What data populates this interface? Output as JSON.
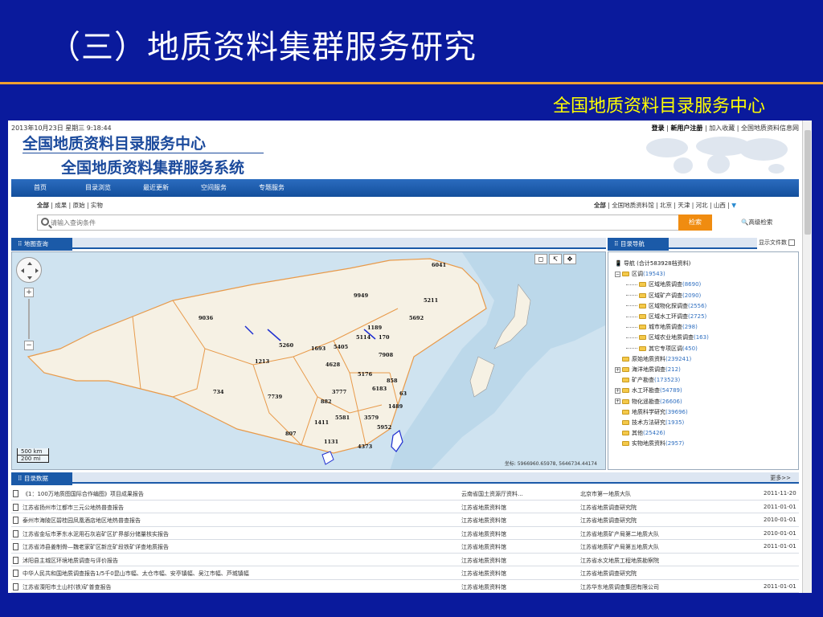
{
  "slide": {
    "title": "（三）地质资料集群服务研究",
    "subtitle": "全国地质资料目录服务中心"
  },
  "header": {
    "datetime": "2013年10月23日 星期三 9:18:44",
    "login": "登录",
    "register": "新用户注册",
    "favorites": "加入收藏",
    "portal": "全国地质资料信息网",
    "logo_main": "全国地质资料目录服务中心",
    "logo_sub": "全国地质资料集群服务系统"
  },
  "nav": [
    "首页",
    "目录浏览",
    "最近更新",
    "空间服务",
    "专题服务"
  ],
  "categories_left": [
    "全部",
    "成果",
    "原始",
    "实物"
  ],
  "categories_right": [
    "全部",
    "全国地质资料馆",
    "北京",
    "天津",
    "河北",
    "山西"
  ],
  "search": {
    "placeholder": "请输入查询条件",
    "button": "检索",
    "advanced": "高级检索"
  },
  "map_panel": {
    "tab": "地图查询",
    "scale_km": "500 km",
    "scale_mi": "200 mi",
    "coords": "坐标: 5966960.65978, 5646734.44174",
    "labels": [
      "6041",
      "9949",
      "5211",
      "9036",
      "5692",
      "1189",
      "5114",
      "170",
      "5260",
      "1693",
      "5405",
      "7908",
      "1213",
      "4628",
      "5176",
      "858",
      "6183",
      "734",
      "7739",
      "3777",
      "63",
      "882",
      "1489",
      "5581",
      "3579",
      "1411",
      "5952",
      "807",
      "1131",
      "4373"
    ]
  },
  "tree_panel": {
    "tab": "目录导航",
    "show_files": "显示文件数",
    "root": "导航 (合计583928档资料)",
    "items": [
      {
        "label": "区调",
        "count": "(19543)",
        "level": 0,
        "toggle": "⊟"
      },
      {
        "label": "区域地质调查",
        "count": "(8690)",
        "level": 1
      },
      {
        "label": "区域矿产调查",
        "count": "(2090)",
        "level": 1
      },
      {
        "label": "区域物化探调查",
        "count": "(2556)",
        "level": 1
      },
      {
        "label": "区域水工环调查",
        "count": "(2725)",
        "level": 1
      },
      {
        "label": "城市地质调查",
        "count": "(298)",
        "level": 1
      },
      {
        "label": "区域农业地质调查",
        "count": "(163)",
        "level": 1
      },
      {
        "label": "其它专项区调",
        "count": "(450)",
        "level": 1
      },
      {
        "label": "原始地质资料",
        "count": "(239241)",
        "level": 0,
        "toggle": ""
      },
      {
        "label": "海洋地质调查",
        "count": "(212)",
        "level": 0,
        "toggle": "⊞"
      },
      {
        "label": "矿产勘查",
        "count": "(173523)",
        "level": 0,
        "toggle": ""
      },
      {
        "label": "水工环勘查",
        "count": "(54789)",
        "level": 0,
        "toggle": "⊞"
      },
      {
        "label": "物化遥勘查",
        "count": "(26606)",
        "level": 0,
        "toggle": "⊞"
      },
      {
        "label": "地质科学研究",
        "count": "(39696)",
        "level": 0,
        "toggle": ""
      },
      {
        "label": "技术方法研究",
        "count": "(1935)",
        "level": 0,
        "toggle": ""
      },
      {
        "label": "其他",
        "count": "(25426)",
        "level": 0,
        "toggle": ""
      },
      {
        "label": "实物地质资料",
        "count": "(2957)",
        "level": 0,
        "toggle": ""
      }
    ]
  },
  "list_panel": {
    "tab": "目录数据",
    "more": "更多>>",
    "rows": [
      [
        "《1：100万地质图国际合作编图》项目成果报告",
        "云南省国土资源厅资料...",
        "北京市第一地质大队",
        "2011-11-20"
      ],
      [
        "江苏省扬州市江都市三元公地热普查报告",
        "江苏省地质资料馆",
        "江苏省地质调查研究院",
        "2011-01-01"
      ],
      [
        "泰州市海陵区碧桂园凤凰酒店地区地热普查报告",
        "江苏省地质资料馆",
        "江苏省地质调查研究院",
        "2010-01-01"
      ],
      [
        "江苏省金坛市茅东水泥用石灰岩矿区扩界部分储量核实报告",
        "江苏省地质资料馆",
        "江苏省地质矿产局第二地质大队",
        "2010-01-01"
      ],
      [
        "江苏省沛县姜制骨—魏老家矿区新庄矿段铁矿详查地质报告",
        "江苏省地质资料馆",
        "江苏省地质矿产局第五地质大队",
        "2011-01-01"
      ],
      [
        "沭阳县主城区环境地质调查与评价报告",
        "江苏省地质资料馆",
        "江苏省水文地质工程地质勘察院",
        ""
      ],
      [
        "中华人民共和国地质调查报告1/5千0昆山市幅、太仓市幅、安亭镇幅、吴江市幅、芦城镇幅",
        "江苏省地质资料馆",
        "江苏省地质调查研究院",
        ""
      ],
      [
        "江苏省溧阳市土山村(铁)矿普查报告",
        "江苏省地质资料馆",
        "江苏华东地质调查集团有限公司",
        "2011-01-01"
      ]
    ]
  },
  "colors": {
    "slide_bg": "#0a1a9c",
    "rule": "#f0a030",
    "subtitle": "#ffff00",
    "brand": "#1b4a9c",
    "search_btn": "#f08c10"
  }
}
